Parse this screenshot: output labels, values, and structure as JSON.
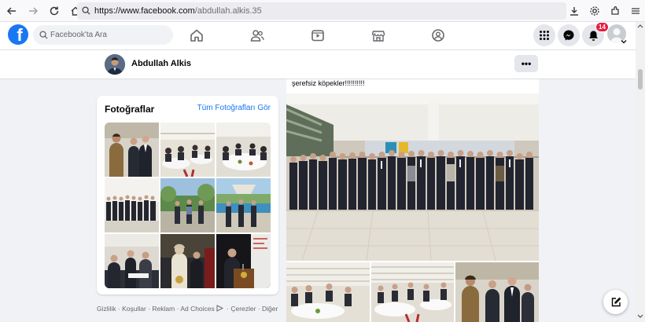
{
  "browser": {
    "url_host": "https://www.facebook.com",
    "url_path": "/abdullah.alkis.35"
  },
  "header": {
    "search_placeholder": "Facebook'ta Ara",
    "notification_count": "14"
  },
  "profile": {
    "name": "Abdullah Alkis",
    "more_label": "•••"
  },
  "photos": {
    "title": "Fotoğraflar",
    "see_all": "Tüm Fotoğrafları Gör"
  },
  "footer": {
    "links": [
      "Gizlilik",
      "Koşullar",
      "Reklam",
      "Ad Choices",
      "Çerezler",
      "Diğer"
    ],
    "separator": " · "
  },
  "post": {
    "text": "şerefsiz köpekler!!!!!!!!!!"
  },
  "colors": {
    "brand": "#1877f2",
    "badge": "#e41e3f"
  }
}
